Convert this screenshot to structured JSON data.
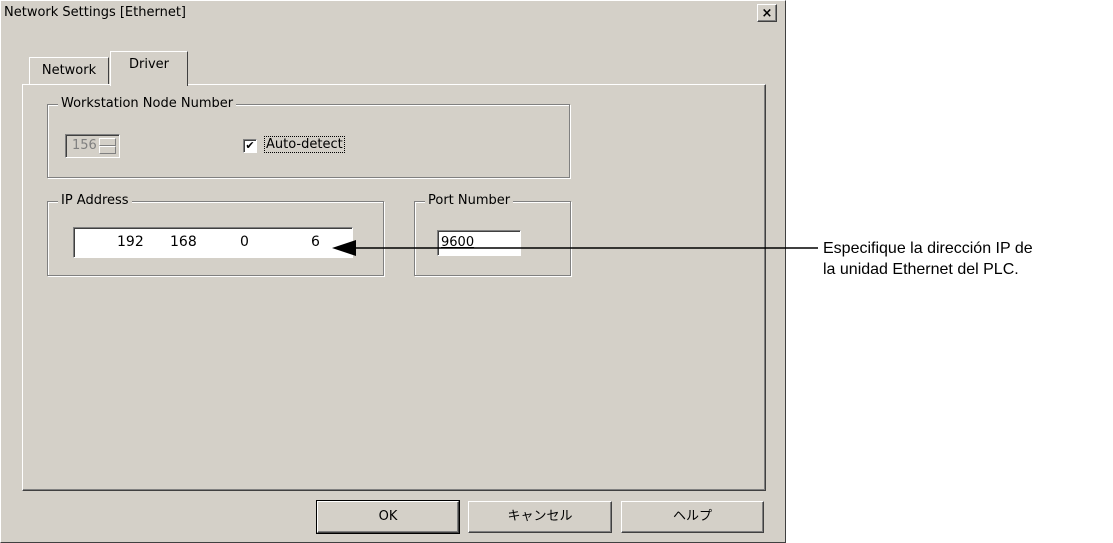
{
  "window": {
    "title": "Network Settings [Ethernet]",
    "close_label": "×"
  },
  "tabs": [
    {
      "label": "Network",
      "active": false
    },
    {
      "label": "Driver",
      "active": true
    }
  ],
  "node_group": {
    "label": "Workstation Node Number",
    "node_value": "156",
    "auto_detect_checked": true,
    "check_mark": "✔",
    "auto_detect_label": "Auto-detect"
  },
  "ip_group": {
    "label": "IP Address",
    "octets": [
      "192",
      "168",
      "0",
      "6"
    ]
  },
  "port_group": {
    "label": "Port Number",
    "value": "9600"
  },
  "buttons": {
    "ok": "OK",
    "cancel": "キャンセル",
    "help": "ヘルプ"
  },
  "annotation": {
    "line1": "Especifique la dirección IP de",
    "line2": "la unidad Ethernet del PLC."
  }
}
